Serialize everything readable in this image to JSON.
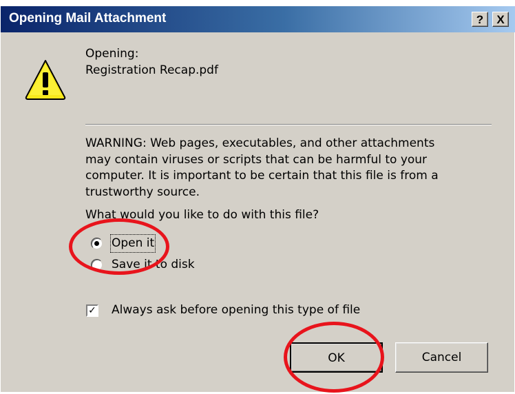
{
  "dialog": {
    "title": "Opening Mail Attachment",
    "help_button": "?",
    "close_button": "X"
  },
  "file": {
    "opening_label": "Opening:",
    "filename": "Registration Recap.pdf"
  },
  "warning_lines": [
    "WARNING: Web pages, executables, and other attachments",
    "may contain viruses or scripts that can be harmful to your",
    "computer. It is important to be certain that this file is from a",
    "trustworthy source."
  ],
  "question": "What would you like to do with this file?",
  "options": [
    {
      "label": "Open it",
      "selected": true
    },
    {
      "label": "Save it to disk",
      "selected": false
    }
  ],
  "always_ask": {
    "label": "Always ask before opening this type of file",
    "checked": true
  },
  "buttons": {
    "ok": "OK",
    "cancel": "Cancel"
  },
  "colors": {
    "annotation_ring": "#e8141c",
    "title_bar": "#0a246a",
    "dialog_bg": "#d4d0c8"
  },
  "icons": {
    "warning": "warning-triangle-icon"
  }
}
